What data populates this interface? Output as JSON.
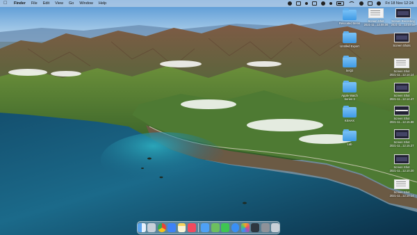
{
  "menubar": {
    "app_name": "Finder",
    "items": [
      "File",
      "Edit",
      "View",
      "Go",
      "Window",
      "Help"
    ],
    "clock": "Fri 18 Nov  12:24"
  },
  "desktop_icons": [
    {
      "kind": "folder",
      "label": "Relocated Items",
      "sub": ""
    },
    {
      "kind": "shot-light",
      "label": "Screen Shot",
      "sub": "2021-11...12.08.06"
    },
    {
      "kind": "shot-dark",
      "label": "Screen Recording",
      "sub": "2021-11...12.23.10"
    },
    {
      "kind": "folder",
      "label": "Untitled Export",
      "sub": ""
    },
    {
      "kind": "shot-dark",
      "label": "Screen Shots",
      "sub": ""
    },
    {
      "kind": "folder",
      "label": "SeQ2",
      "sub": ""
    },
    {
      "kind": "shot-light",
      "label": "Screen Shot",
      "sub": "2021-11...12.14.14"
    },
    {
      "kind": "folder",
      "label": "Apple Watch",
      "sub": "Series 3"
    },
    {
      "kind": "shot-dark",
      "label": "Screen Shot",
      "sub": "2021-11...12.14.47"
    },
    {
      "kind": "folder",
      "label": "KSHAX",
      "sub": ""
    },
    {
      "kind": "shot-bar",
      "label": "Screen Shot",
      "sub": "2021-11...12.15.88"
    },
    {
      "kind": "folder",
      "label": "Lab",
      "sub": ""
    },
    {
      "kind": "shot-dark",
      "label": "Screen Shot",
      "sub": "2021-11...12.15.27"
    },
    {
      "kind": "shot-dark",
      "label": "Screen Shot",
      "sub": "2021-11...12.10.20"
    },
    {
      "kind": "shot-light",
      "label": "Screen Shot",
      "sub": "2021-11...12.10.14"
    }
  ],
  "dock": {
    "apps": [
      "finder",
      "launchpad",
      "chrome",
      "app-store",
      "notes",
      "music",
      "mail",
      "maps",
      "facetime",
      "safari",
      "photos",
      "wallet",
      "system-preferences",
      "trash"
    ],
    "colors": {
      "finder": "#5aa4f0",
      "launchpad": "#c7cfd9",
      "chrome": "#e9e9e9",
      "app-store": "#3e82f7",
      "notes": "#f7d35c",
      "music": "#f24a5e",
      "mail": "#4ea1f5",
      "maps": "#6cbf5f",
      "facetime": "#3fc552",
      "safari": "#3a8ff5",
      "photos": "#f4f4f4",
      "wallet": "#2e3740",
      "system-preferences": "#8e9299",
      "trash": "#c9d0d8"
    }
  }
}
